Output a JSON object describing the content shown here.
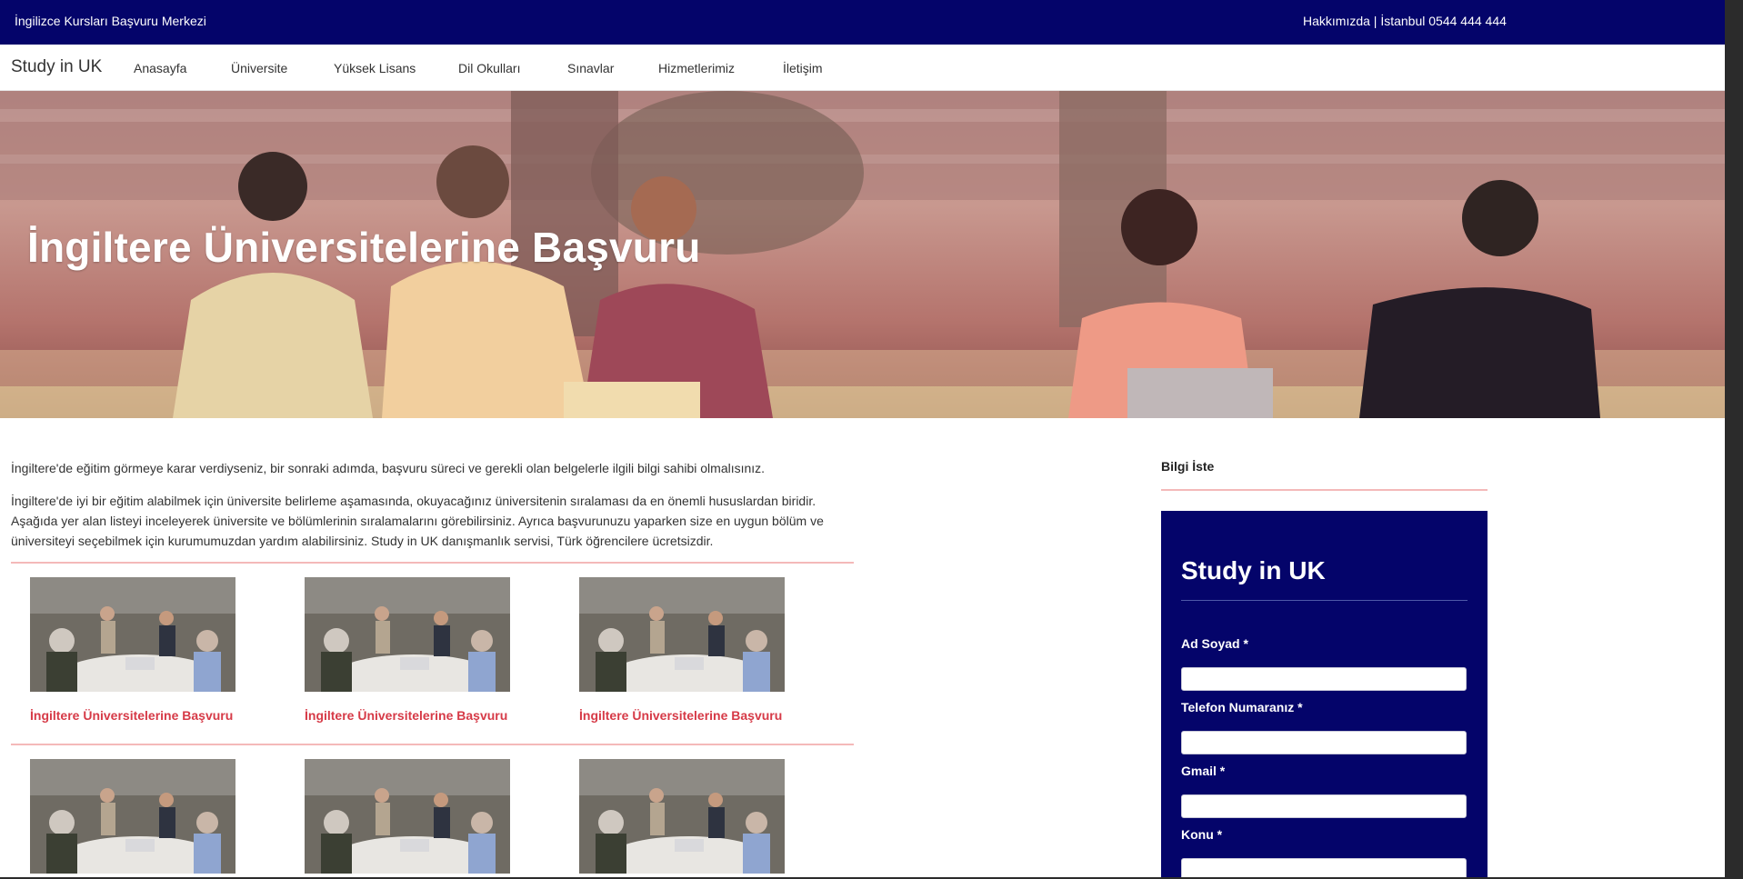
{
  "topbar": {
    "left_text": "İngilizce Kursları Başvuru Merkezi",
    "right_text": "Hakkımızda | İstanbul 0544 444 444"
  },
  "navbar": {
    "brand": "Study in UK",
    "links": [
      "Anasayfa",
      "Üniversite",
      "Yüksek Lisans",
      "Dil Okulları",
      "Sınavlar",
      "Hizmetlerimiz",
      "İletişim"
    ]
  },
  "hero": {
    "title": "İngiltere Üniversitelerine Başvuru"
  },
  "intro": {
    "p1": "İngiltere'de eğitim görmeye karar verdiyseniz, bir sonraki adımda, başvuru süreci ve gerekli olan belgelerle ilgili bilgi sahibi olmalısınız.",
    "p2": "İngiltere'de iyi bir eğitim alabilmek için üniversite belirleme aşamasında, okuyacağınız üniversitenin sıralaması da en önemli hususlardan biridir. Aşağıda yer alan listeyi inceleyerek üniversite ve bölümlerinin sıralamalarını görebilirsiniz. Ayrıca başvurunuzu yaparken size en uygun bölüm ve üniversiteyi seçebilmek için kurumumuzdan yardım alabilirsiniz. Study in UK danışmanlık servisi, Türk öğrencilere ücretsizdir."
  },
  "cards": [
    {
      "caption": "İngiltere Üniversitelerine Başvuru"
    },
    {
      "caption": "İngiltere Üniversitelerine Başvuru"
    },
    {
      "caption": "İngiltere Üniversitelerine Başvuru"
    },
    {
      "caption": ""
    },
    {
      "caption": ""
    },
    {
      "caption": ""
    }
  ],
  "sidebar": {
    "title": "Bilgi İste",
    "form": {
      "title": "Study in UK",
      "fields": [
        {
          "label": "Ad Soyad *",
          "value": ""
        },
        {
          "label": "Telefon Numaranız *",
          "value": ""
        },
        {
          "label": "Gmail *",
          "value": ""
        },
        {
          "label": "Konu *",
          "value": ""
        }
      ]
    }
  },
  "colors": {
    "brand_navy": "#04046a",
    "caption_red": "#d63a47",
    "divider_pink": "#f4b9b9"
  }
}
